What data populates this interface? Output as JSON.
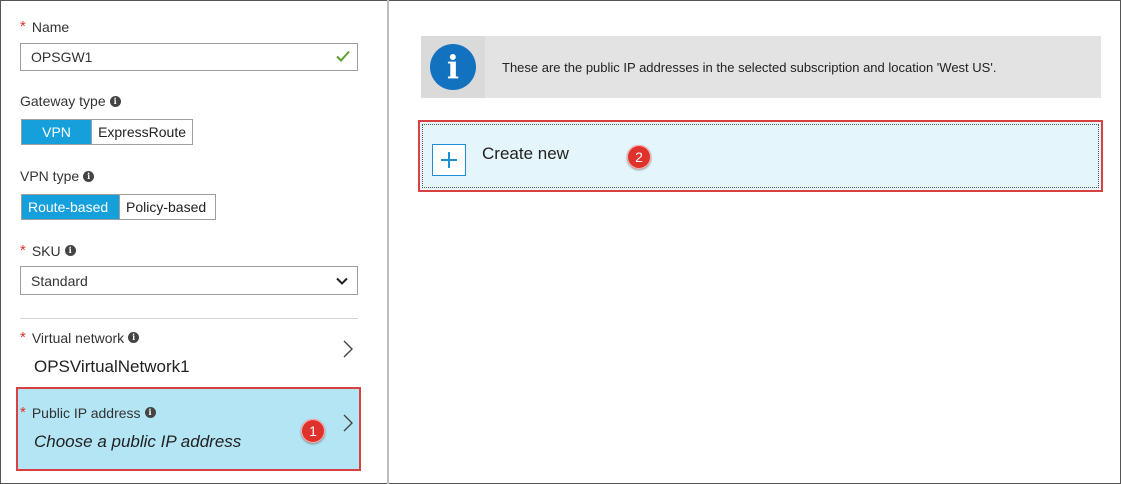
{
  "form": {
    "name": {
      "label": "Name",
      "value": "OPSGW1",
      "required_marker": "*"
    },
    "gateway_type": {
      "label": "Gateway type",
      "options": [
        "VPN",
        "ExpressRoute"
      ],
      "selected": "VPN"
    },
    "vpn_type": {
      "label": "VPN type",
      "options": [
        "Route-based",
        "Policy-based"
      ],
      "selected": "Route-based"
    },
    "sku": {
      "label": "SKU",
      "value": "Standard",
      "required_marker": "*"
    },
    "virtual_network": {
      "label": "Virtual network",
      "value": "OPSVirtualNetwork1",
      "required_marker": "*"
    },
    "public_ip": {
      "label": "Public IP address",
      "value": "Choose a public IP address",
      "required_marker": "*",
      "step": "1"
    }
  },
  "right_panel": {
    "info_message": "These are the public IP addresses in the selected subscription and location 'West US'.",
    "create_new_label": "Create new",
    "create_step": "2"
  },
  "colors": {
    "accent": "#16a0db",
    "selected_row": "#b3e5f5",
    "highlight_border": "#d94040",
    "info_icon": "#1272c0",
    "required": "#d9342b"
  }
}
